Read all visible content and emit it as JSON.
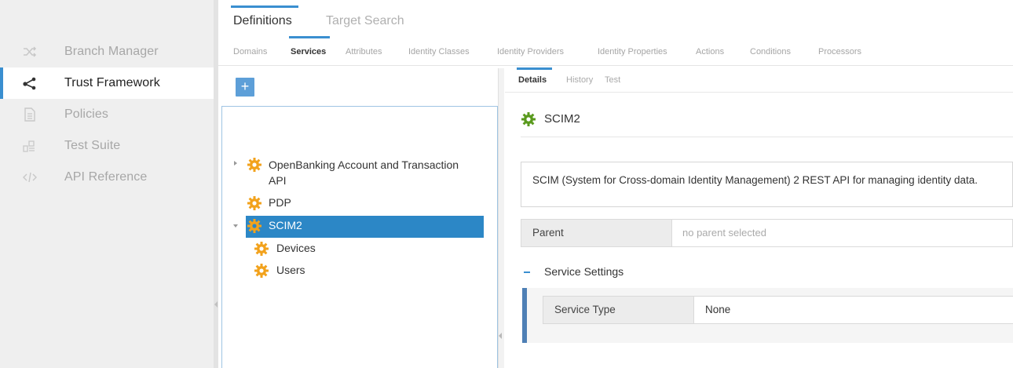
{
  "nav": {
    "items": [
      {
        "label": "Branch Manager",
        "icon": "shuffle-icon"
      },
      {
        "label": "Trust Framework",
        "icon": "share-icon"
      },
      {
        "label": "Policies",
        "icon": "document-icon"
      },
      {
        "label": "Test Suite",
        "icon": "test-suite-icon"
      },
      {
        "label": "API Reference",
        "icon": "code-icon"
      }
    ]
  },
  "top_tabs": [
    "Definitions",
    "Target Search"
  ],
  "sub_tabs": [
    "Domains",
    "Services",
    "Attributes",
    "Identity Classes",
    "Identity Providers",
    "Identity Properties",
    "Actions",
    "Conditions",
    "Processors"
  ],
  "tree": {
    "add_label": "+",
    "items": [
      {
        "label_line1": "OpenBanking Account and Transaction",
        "label_line2": "API"
      },
      {
        "label": "PDP"
      },
      {
        "label": "SCIM2"
      },
      {
        "label": "Devices"
      },
      {
        "label": "Users"
      }
    ]
  },
  "detail": {
    "tabs": [
      "Details",
      "History",
      "Test"
    ],
    "title": "SCIM2",
    "description": "SCIM (System for Cross-domain Identity Management) 2 REST API for managing identity data.",
    "parent_label": "Parent",
    "parent_placeholder": "no parent selected",
    "section_title": "Service Settings",
    "service_type_label": "Service Type",
    "service_type_value": "None"
  },
  "colors": {
    "accent": "#3a8fd0",
    "selected": "#2c87c6",
    "gear_orange": "#f2a21c",
    "gear_green": "#5a9a1e",
    "settings_bar": "#4e7fb5"
  }
}
